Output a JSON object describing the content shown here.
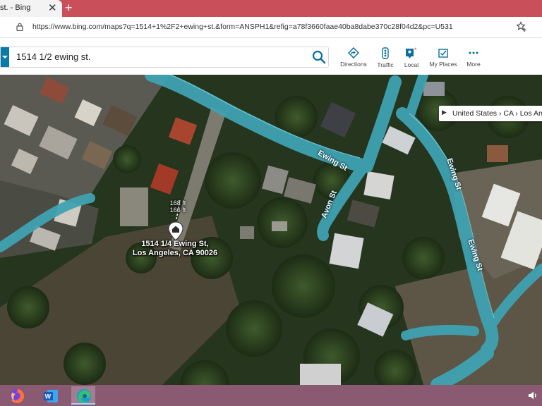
{
  "tab": {
    "title": "st. - Bing",
    "close": "✕",
    "new_tab": "+"
  },
  "address_bar": {
    "url": "https://www.bing.com/maps?q=1514+1%2F2+ewing+st.&form=ANSPH1&refig=a78f3660faae40ba8dabe370c28f04d2&pc=U531"
  },
  "search": {
    "value": "1514 1/2 ewing st."
  },
  "toolbar": [
    {
      "label": "Directions",
      "icon": "directions-icon"
    },
    {
      "label": "Traffic",
      "icon": "traffic-icon"
    },
    {
      "label": "Local",
      "icon": "local-icon"
    },
    {
      "label": "My Places",
      "icon": "my-places-icon"
    },
    {
      "label": "More",
      "icon": "more-icon"
    }
  ],
  "map": {
    "breadcrumb": "United States  ›  CA  ›  Los Angeles",
    "pin_address": [
      "1514 1/4 Ewing St,",
      "Los Angeles, CA 90026"
    ],
    "distance": [
      "168 ft",
      "166 ft"
    ],
    "streets": {
      "ewing_1": "Ewing St",
      "ewing_2": "Ewing St",
      "ewing_3": "Ewing St",
      "avon": "Avon St"
    },
    "colors": {
      "road": "#52b6c4",
      "terrain": "#2b3a22"
    }
  },
  "taskbar": {
    "apps": [
      "firefox-icon",
      "word-icon",
      "edge-icon"
    ],
    "tray": "speaker-icon"
  }
}
